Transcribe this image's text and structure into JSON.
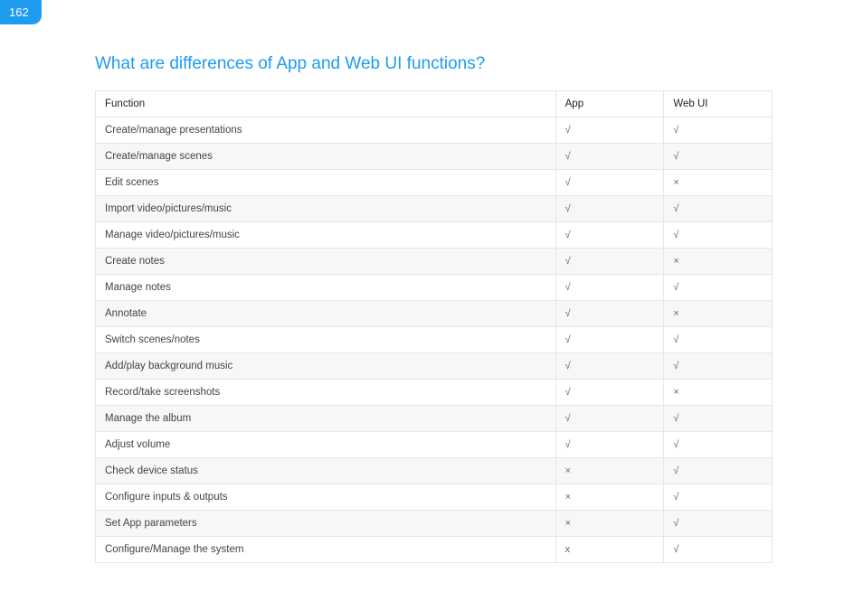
{
  "page_number": "162",
  "title": "What are differences of App and Web UI functions?",
  "headers": {
    "function": "Function",
    "app": "App",
    "web": "Web UI"
  },
  "rows": [
    {
      "function": "Create/manage presentations",
      "app": "√",
      "web": "√"
    },
    {
      "function": "Create/manage scenes",
      "app": "√",
      "web": "√"
    },
    {
      "function": "Edit scenes",
      "app": "√",
      "web": "×"
    },
    {
      "function": "Import video/pictures/music",
      "app": "√",
      "web": "√"
    },
    {
      "function": "Manage video/pictures/music",
      "app": "√",
      "web": "√"
    },
    {
      "function": "Create notes",
      "app": "√",
      "web": "×"
    },
    {
      "function": "Manage notes",
      "app": "√",
      "web": "√"
    },
    {
      "function": "Annotate",
      "app": "√",
      "web": "×"
    },
    {
      "function": "Switch scenes/notes",
      "app": "√",
      "web": "√"
    },
    {
      "function": "Add/play background music",
      "app": "√",
      "web": "√"
    },
    {
      "function": "Record/take screenshots",
      "app": "√",
      "web": "×"
    },
    {
      "function": "Manage the album",
      "app": "√",
      "web": "√"
    },
    {
      "function": "Adjust volume",
      "app": "√",
      "web": "√"
    },
    {
      "function": "Check device status",
      "app": "×",
      "web": "√"
    },
    {
      "function": "Configure inputs & outputs",
      "app": "×",
      "web": "√"
    },
    {
      "function": "Set App parameters",
      "app": "×",
      "web": "√"
    },
    {
      "function": "Configure/Manage the system",
      "app": "x",
      "web": "√"
    }
  ]
}
